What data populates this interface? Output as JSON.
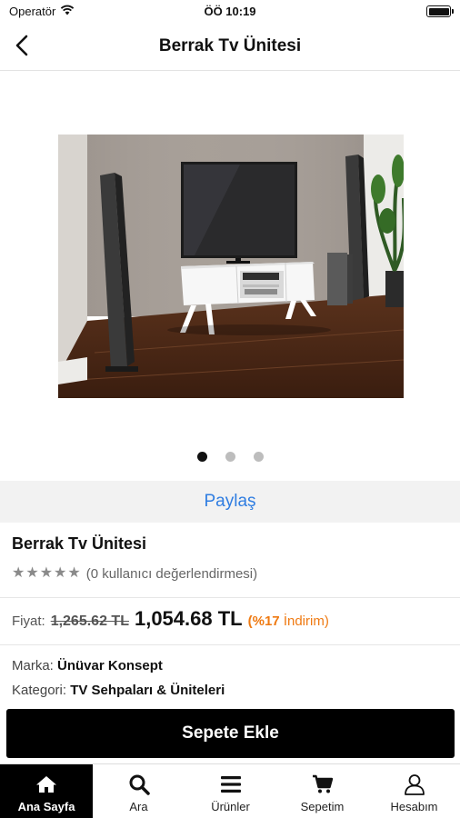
{
  "status_bar": {
    "carrier": "Operatör",
    "time": "ÖÖ 10:19"
  },
  "nav": {
    "title": "Berrak Tv Ünitesi"
  },
  "carousel": {
    "total": 3,
    "active_index": 0
  },
  "share": {
    "label": "Paylaş"
  },
  "product": {
    "name": "Berrak Tv Ünitesi",
    "rating": 0,
    "rating_text": "(0 kullanıcı değerlendirmesi)",
    "price_label": "Fiyat:",
    "old_price": "1,265.62 TL",
    "new_price": "1,054.68 TL",
    "discount_pct": "(%17",
    "discount_word": "İndirim)",
    "brand_label": "Marka:",
    "brand": "Ünüvar Konsept",
    "category_label": "Kategori:",
    "category": "TV Sehpaları & Üniteleri"
  },
  "cart_button": {
    "label": "Sepete Ekle"
  },
  "tabs": [
    {
      "label": "Ana Sayfa",
      "icon": "home-icon"
    },
    {
      "label": "Ara",
      "icon": "search-icon"
    },
    {
      "label": "Ürünler",
      "icon": "menu-icon"
    },
    {
      "label": "Sepetim",
      "icon": "cart-icon"
    },
    {
      "label": "Hesabım",
      "icon": "user-icon"
    }
  ],
  "colors": {
    "accent_link": "#2f7de1",
    "discount": "#ef7a12",
    "active_tab_bg": "#000000"
  }
}
